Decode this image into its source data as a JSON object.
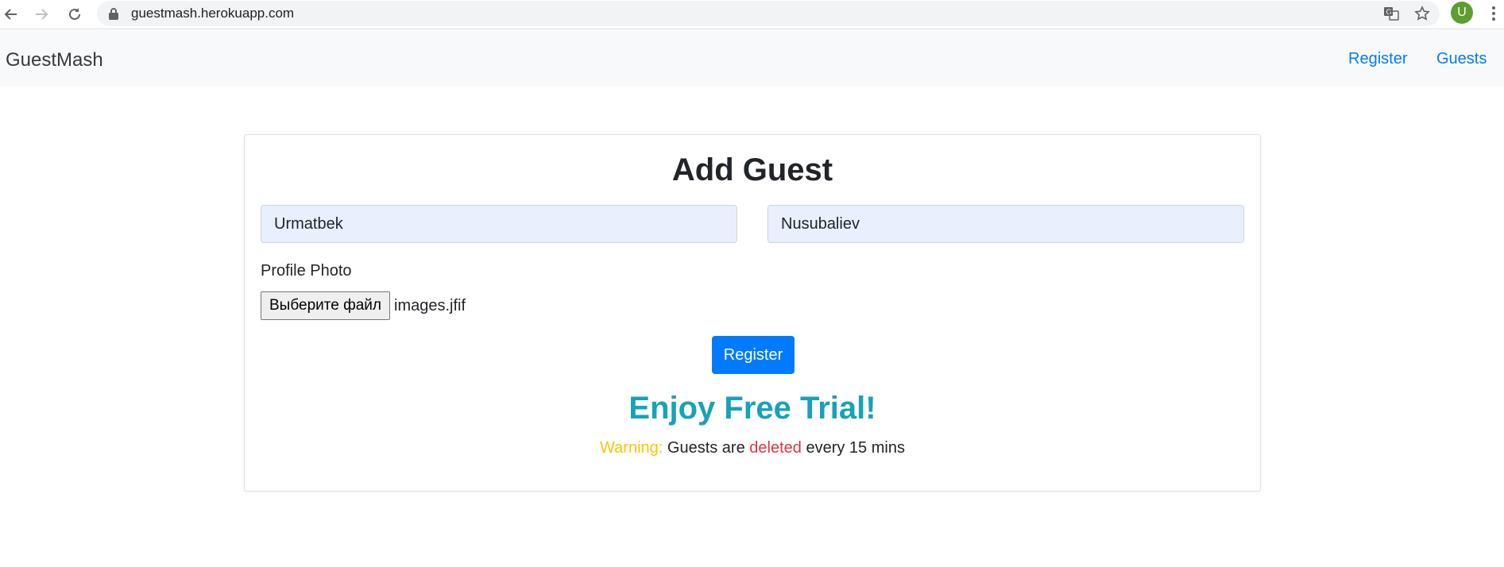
{
  "browser": {
    "url": "guestmash.herokuapp.com",
    "profile_initial": "U",
    "profile_color": "#5c9e31"
  },
  "navbar": {
    "brand": "GuestMash",
    "links": [
      "Register",
      "Guests"
    ],
    "link_color": "#007bff"
  },
  "form": {
    "title": "Add Guest",
    "first_name_value": "Urmatbek",
    "last_name_value": "Nusubaliev",
    "photo_label": "Profile Photo",
    "file_button_label": "Выберите файл",
    "file_name": "images.jfif",
    "submit_label": "Register",
    "submit_color": "#007bff"
  },
  "promo": {
    "heading": "Enjoy Free Trial!",
    "heading_color": "#17a2b8",
    "warning_label": "Warning:",
    "note_part1": "Guests are",
    "deleted_word": "deleted",
    "note_part2": "every 15 mins"
  },
  "icons": [
    "back-arrow-icon",
    "forward-arrow-icon",
    "reload-icon",
    "lock-icon",
    "translate-icon",
    "star-icon",
    "menu-dots-icon"
  ]
}
